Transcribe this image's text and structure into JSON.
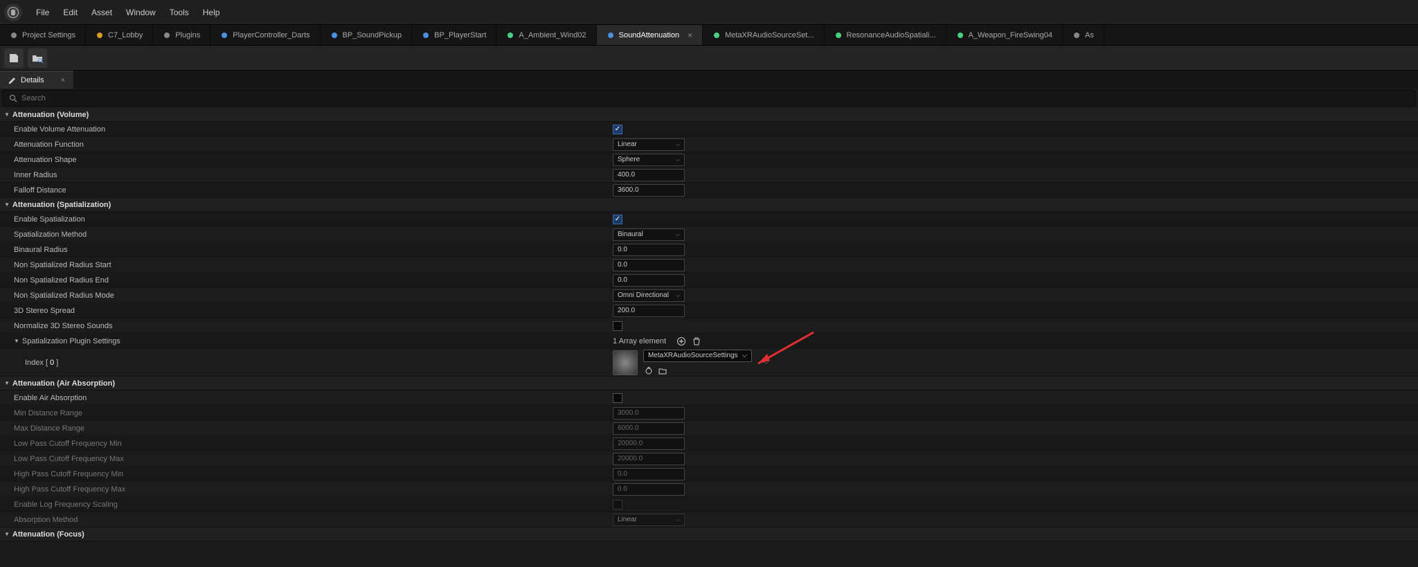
{
  "menu": {
    "file": "File",
    "edit": "Edit",
    "asset": "Asset",
    "window": "Window",
    "tools": "Tools",
    "help": "Help"
  },
  "tabs": [
    {
      "label": "Project Settings",
      "icon": "settings",
      "color": "#888"
    },
    {
      "label": "C7_Lobby",
      "icon": "level",
      "color": "#d4a020"
    },
    {
      "label": "Plugins",
      "icon": "plugin",
      "color": "#888"
    },
    {
      "label": "PlayerController_Darts",
      "icon": "bp",
      "color": "#4a90e2"
    },
    {
      "label": "BP_SoundPickup",
      "icon": "bp",
      "color": "#4a90e2"
    },
    {
      "label": "BP_PlayerStart",
      "icon": "bp",
      "color": "#4a90e2"
    },
    {
      "label": "A_Ambient_Wind02",
      "icon": "audio",
      "color": "#4ad080"
    },
    {
      "label": "SoundAttenuation",
      "icon": "atten",
      "color": "#4a90e2",
      "active": true
    },
    {
      "label": "MetaXRAudioSourceSet...",
      "icon": "atten",
      "color": "#4ad080"
    },
    {
      "label": "ResonanceAudioSpatiali...",
      "icon": "atten",
      "color": "#4ad080"
    },
    {
      "label": "A_Weapon_FireSwing04",
      "icon": "audio",
      "color": "#4ad080"
    },
    {
      "label": "As",
      "icon": "",
      "color": "#888"
    }
  ],
  "panel": {
    "details": "Details"
  },
  "search": {
    "placeholder": "Search"
  },
  "cats": {
    "vol": "Attenuation (Volume)",
    "spat": "Attenuation (Spatialization)",
    "air": "Attenuation (Air Absorption)",
    "focus": "Attenuation (Focus)"
  },
  "props": {
    "enableVolAtt": "Enable Volume Attenuation",
    "attFunc": "Attenuation Function",
    "attFuncVal": "Linear",
    "attShape": "Attenuation Shape",
    "attShapeVal": "Sphere",
    "innerRad": "Inner Radius",
    "innerRadVal": "400.0",
    "falloff": "Falloff Distance",
    "falloffVal": "3600.0",
    "enableSpat": "Enable Spatialization",
    "spatMethod": "Spatialization Method",
    "spatMethodVal": "Binaural",
    "binRad": "Binaural Radius",
    "binRadVal": "0.0",
    "nsRadStart": "Non Spatialized Radius Start",
    "nsRadStartVal": "0.0",
    "nsRadEnd": "Non Spatialized Radius End",
    "nsRadEndVal": "0.0",
    "nsRadMode": "Non Spatialized Radius Mode",
    "nsRadModeVal": "Omni Directional",
    "stereoSpread": "3D Stereo Spread",
    "stereoSpreadVal": "200.0",
    "norm3d": "Normalize 3D Stereo Sounds",
    "spatPlugin": "Spatialization Plugin Settings",
    "spatPluginVal": "1 Array element",
    "index0": "Index [ 0 ]",
    "index0Val": "MetaXRAudioSourceSettings",
    "enableAir": "Enable Air Absorption",
    "minDist": "Min Distance Range",
    "minDistVal": "3000.0",
    "maxDist": "Max Distance Range",
    "maxDistVal": "6000.0",
    "lpMin": "Low Pass Cutoff Frequency Min",
    "lpMinVal": "20000.0",
    "lpMax": "Low Pass Cutoff Frequency Max",
    "lpMaxVal": "20000.0",
    "hpMin": "High Pass Cutoff Frequency Min",
    "hpMinVal": "0.0",
    "hpMax": "High Pass Cutoff Frequency Max",
    "hpMaxVal": "0.0",
    "enableLog": "Enable Log Frequency Scaling",
    "absMethod": "Absorption Method",
    "absMethodVal": "Linear"
  }
}
